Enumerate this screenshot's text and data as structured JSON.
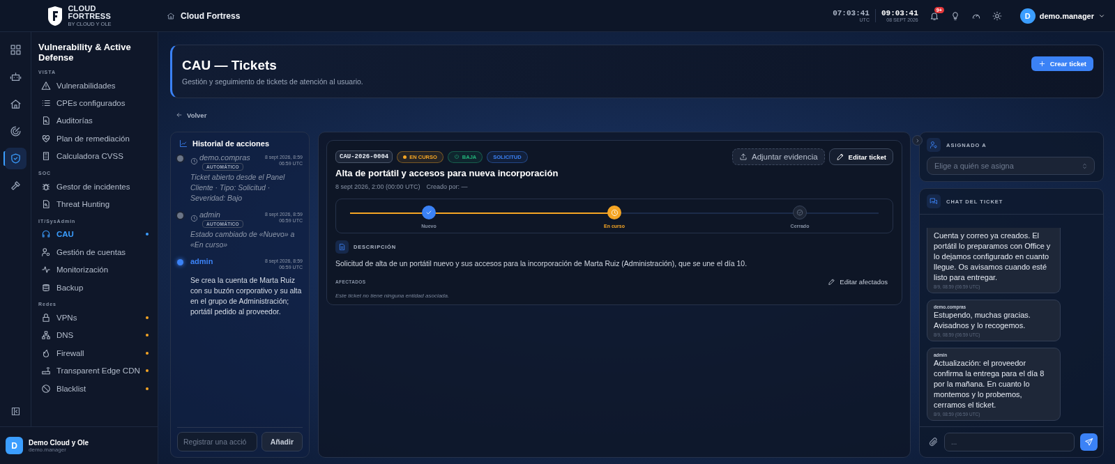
{
  "topbar": {
    "logo_line1": "CLOUD",
    "logo_line2": "FORTRESS",
    "logo_sub": "BY CLOUD Y OLE",
    "breadcrumb": "Cloud Fortress",
    "clocks": [
      {
        "time": "07:03:41",
        "caption": "UTC"
      },
      {
        "time": "09:03:41",
        "caption": "08 SEPT 2026"
      }
    ],
    "notification_count": "9+",
    "user_initial": "D",
    "user_name": "demo.manager"
  },
  "rail": [
    {
      "selected": false
    },
    {
      "selected": false
    },
    {
      "selected": false
    },
    {
      "selected": false
    },
    {
      "selected": true
    },
    {
      "selected": false
    }
  ],
  "sidebar": {
    "title": "Vulnerability & Active Defense",
    "sections": [
      {
        "label": "VISTA",
        "items": [
          {
            "label": "Vulnerabilidades",
            "selected": false
          },
          {
            "label": "CPEs configurados",
            "selected": false
          },
          {
            "label": "Auditorías",
            "selected": false
          },
          {
            "label": "Plan de remediación",
            "selected": false
          },
          {
            "label": "Calculadora CVSS",
            "selected": false
          }
        ]
      },
      {
        "label": "SOC",
        "items": [
          {
            "label": "Gestor de incidentes",
            "selected": false
          },
          {
            "label": "Threat Hunting",
            "selected": false
          }
        ]
      },
      {
        "label": "IT/SysAdmin",
        "items": [
          {
            "label": "CAU",
            "selected": true,
            "color": "#3b9eff"
          },
          {
            "label": "Gestión de cuentas",
            "selected": false
          },
          {
            "label": "Monitorización",
            "selected": false
          },
          {
            "label": "Backup",
            "selected": false
          }
        ]
      },
      {
        "label": "Redes",
        "items": [
          {
            "label": "VPNs",
            "selected": false,
            "color": "#f5a524"
          },
          {
            "label": "DNS",
            "selected": false,
            "color": "#f5a524"
          },
          {
            "label": "Firewall",
            "selected": false,
            "color": "#f5a524"
          },
          {
            "label": "Transparent Edge CDN",
            "selected": false,
            "color": "#f5a524"
          },
          {
            "label": "Blacklist",
            "selected": false,
            "color": "#f5a524"
          }
        ]
      }
    ],
    "footer": {
      "initial": "D",
      "name": "Demo Cloud y Ole",
      "user": "demo.manager"
    }
  },
  "page": {
    "title": "CAU — Tickets",
    "subtitle": "Gestión y seguimiento de tickets de atención al usuario.",
    "create_button": "Crear ticket",
    "back": "Volver"
  },
  "history": {
    "title": "Historial de acciones",
    "entries": [
      {
        "kind": "automatic",
        "author": "demo.compras",
        "badge": "AUTOMÁTICO",
        "date": "8 sept 2026, 8:59",
        "time": "06:59 UTC",
        "text": "Ticket abierto desde el Panel Cliente · Tipo: Solicitud · Severidad: Bajo"
      },
      {
        "kind": "automatic",
        "author": "admin",
        "badge": "AUTOMÁTICO",
        "date": "8 sept 2026, 8:59",
        "time": "06:59 UTC",
        "text": "Estado cambiado de «Nuevo» a «En curso»"
      },
      {
        "kind": "manual",
        "author": "admin",
        "date": "8 sept 2026, 8:59",
        "time": "06:59 UTC",
        "text": "Se crea la cuenta de Marta Ruiz con su buzón corporativo y su alta en el grupo de Administración; portátil pedido al proveedor."
      }
    ],
    "input_placeholder": "Registrar una acció",
    "add_button": "Añadir"
  },
  "ticket": {
    "id": "CAU-2026-0004",
    "tags": [
      {
        "kind": "dot",
        "label": "EN CURSO",
        "color": "#f5a524"
      },
      {
        "kind": "icon",
        "label": "BAJA",
        "color": "#22b37a"
      },
      {
        "kind": "plain",
        "label": "SOLICITUD",
        "color": "#3b82f6"
      }
    ],
    "actions": [
      {
        "kind": "dashed",
        "label": "Adjuntar evidencia"
      },
      {
        "kind": "solid",
        "label": "Editar ticket"
      }
    ],
    "title": "Alta de portátil y accesos para nueva incorporación",
    "date": "8 sept 2026, 2:00 (00:00 UTC)",
    "created_by": "Creado por: —",
    "steps": [
      {
        "label": "Nuevo",
        "completed": true,
        "selected": false
      },
      {
        "label": "En curso",
        "completed": false,
        "selected": true
      },
      {
        "label": "Cerrado",
        "completed": false,
        "selected": false
      }
    ],
    "description": {
      "heading": "DESCRIPCIÓN",
      "text": "Solicitud de alta de un portátil nuevo y sus accesos para la incorporación de Marta Ruiz (Administración), que se une el día 10."
    },
    "affected": {
      "heading": "AFECTADOS",
      "action": "Editar afectados",
      "empty": "Este ticket no tiene ninguna entidad asociada."
    }
  },
  "assign": {
    "heading": "ASIGNADO A",
    "placeholder": "Elige a quién se asigna"
  },
  "chat": {
    "heading": "CHAT DEL TICKET",
    "messages": [
      {
        "text": "Cuenta y correo ya creados. El portátil lo preparamos con Office y lo dejamos configurado en cuanto llegue. Os avisamos cuando esté listo para entregar.",
        "time": "8/9, 08:59 (06:59 UTC)"
      },
      {
        "author": "demo.compras",
        "text": "Estupendo, muchas gracias. Avisadnos y lo recogemos.",
        "time": "8/9, 08:59 (06:59 UTC)"
      },
      {
        "author": "admin",
        "text": "Actualización: el proveedor confirma la entrega para el día 8 por la mañana. En cuanto lo montemos y lo probemos, cerramos el ticket.",
        "time": "8/9, 08:59 (06:59 UTC)"
      }
    ],
    "input_placeholder": "..."
  }
}
